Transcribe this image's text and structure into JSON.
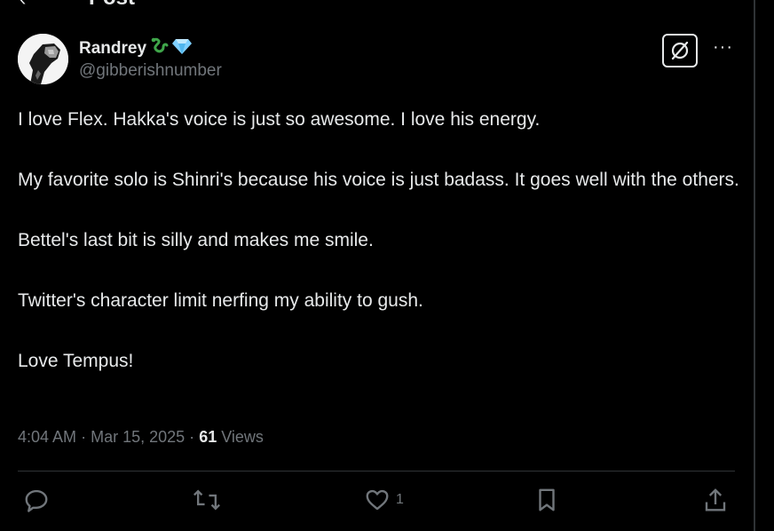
{
  "header": {
    "back_icon": "back-arrow-icon",
    "title": "Post"
  },
  "author": {
    "name": "Randrey",
    "badges": [
      "snake-icon",
      "diamond-icon"
    ],
    "handle": "@gibberishnumber"
  },
  "actions_top": {
    "grok_icon": "slashed-circle-icon",
    "more_label": "···"
  },
  "post": {
    "paragraphs": [
      "I love Flex. Hakka's voice is just so awesome. I love his energy.",
      "My favorite solo is Shinri's because his voice is just badass. It goes well with the others.",
      "Bettel's last bit is silly and makes me smile.",
      "Twitter's character limit nerfing my ability to gush.",
      "Love Tempus!"
    ]
  },
  "meta": {
    "time": "4:04 AM",
    "separator": "·",
    "date": "Mar 15, 2025",
    "views_count": "61",
    "views_label": "Views"
  },
  "engagement": {
    "reply": {
      "icon": "reply-icon",
      "count": ""
    },
    "repost": {
      "icon": "repost-icon",
      "count": ""
    },
    "like": {
      "icon": "heart-icon",
      "count": "1"
    },
    "bookmark": {
      "icon": "bookmark-icon"
    },
    "share": {
      "icon": "share-icon"
    }
  },
  "colors": {
    "background": "#000000",
    "text": "#e7e9ea",
    "muted": "#71767b",
    "border": "#2f3336"
  }
}
